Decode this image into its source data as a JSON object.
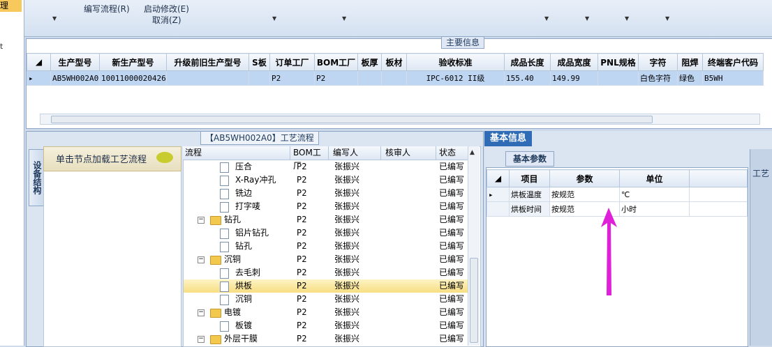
{
  "left_strip": {
    "selected": "理",
    "item2": "t"
  },
  "ribbon": {
    "write_flow": "编写流程(R)",
    "start_modify": "启动修改(E)",
    "cancel": "取消(Z)"
  },
  "main_info": {
    "title": "主要信息",
    "columns": [
      "生产型号",
      "新生产型号",
      "升级前旧生产型号",
      "S板",
      "订单工厂",
      "BOM工厂",
      "板厚",
      "板材",
      "验收标准",
      "成品长度",
      "成品宽度",
      "PNL规格",
      "字符",
      "阻焊",
      "终端客户代码"
    ],
    "rows": [
      [
        "AB5WH002A0",
        "10011000020426",
        "",
        "",
        "P2",
        "P2",
        "",
        "",
        "IPC-6012 II级",
        "155.40",
        "149.99",
        "",
        "白色字符",
        "绿色",
        "B5WH"
      ]
    ]
  },
  "flow_panel": {
    "title": "【AB5WH002A0】工艺流程",
    "vertical_tab": "设备结构",
    "load_text": "单击节点加载工艺流程",
    "columns": [
      "流程",
      "BOM工厂",
      "编写人",
      "核审人",
      "状态"
    ],
    "rows": [
      {
        "name": "压合",
        "type": "doc",
        "level": 2,
        "bom": "P2",
        "writer": "张振兴",
        "reviewer": "",
        "status": "已编写"
      },
      {
        "name": "X-Ray冲孔",
        "type": "doc",
        "level": 2,
        "bom": "P2",
        "writer": "张振兴",
        "reviewer": "",
        "status": "已编写"
      },
      {
        "name": "铣边",
        "type": "doc",
        "level": 2,
        "bom": "P2",
        "writer": "张振兴",
        "reviewer": "",
        "status": "已编写"
      },
      {
        "name": "打字唛",
        "type": "doc",
        "level": 2,
        "bom": "P2",
        "writer": "张振兴",
        "reviewer": "",
        "status": "已编写"
      },
      {
        "name": "钻孔",
        "type": "folder",
        "level": 1,
        "bom": "P2",
        "writer": "张振兴",
        "reviewer": "",
        "status": "已编写"
      },
      {
        "name": "铝片钻孔",
        "type": "doc",
        "level": 2,
        "bom": "P2",
        "writer": "张振兴",
        "reviewer": "",
        "status": "已编写"
      },
      {
        "name": "钻孔",
        "type": "doc",
        "level": 2,
        "bom": "P2",
        "writer": "张振兴",
        "reviewer": "",
        "status": "已编写"
      },
      {
        "name": "沉铜",
        "type": "folder",
        "level": 1,
        "bom": "P2",
        "writer": "张振兴",
        "reviewer": "",
        "status": "已编写"
      },
      {
        "name": "去毛刺",
        "type": "doc",
        "level": 2,
        "bom": "P2",
        "writer": "张振兴",
        "reviewer": "",
        "status": "已编写"
      },
      {
        "name": "烘板",
        "type": "doc",
        "level": 2,
        "bom": "P2",
        "writer": "张振兴",
        "reviewer": "",
        "status": "已编写",
        "highlight": true
      },
      {
        "name": "沉铜",
        "type": "doc",
        "level": 2,
        "bom": "P2",
        "writer": "张振兴",
        "reviewer": "",
        "status": "已编写"
      },
      {
        "name": "电镀",
        "type": "folder",
        "level": 1,
        "bom": "P2",
        "writer": "张振兴",
        "reviewer": "",
        "status": "已编写"
      },
      {
        "name": "板镀",
        "type": "doc",
        "level": 2,
        "bom": "P2",
        "writer": "张振兴",
        "reviewer": "",
        "status": "已编写"
      },
      {
        "name": "外层干膜",
        "type": "folder",
        "level": 1,
        "bom": "P2",
        "writer": "张振兴",
        "reviewer": "",
        "status": "已编写"
      }
    ]
  },
  "basic_info": {
    "tab": "基本信息",
    "subtab": "基本参数",
    "columns": [
      "项目",
      "参数",
      "单位"
    ],
    "rows": [
      {
        "item": "烘板温度",
        "param": "按规范",
        "unit": "℃"
      },
      {
        "item": "烘板时间",
        "param": "按规范",
        "unit": "小时"
      }
    ],
    "far_right_tab": "工艺"
  },
  "colors": {
    "accent": "#2f6cb5",
    "highlight": "#f7de82",
    "annotation": "#e020d8"
  }
}
